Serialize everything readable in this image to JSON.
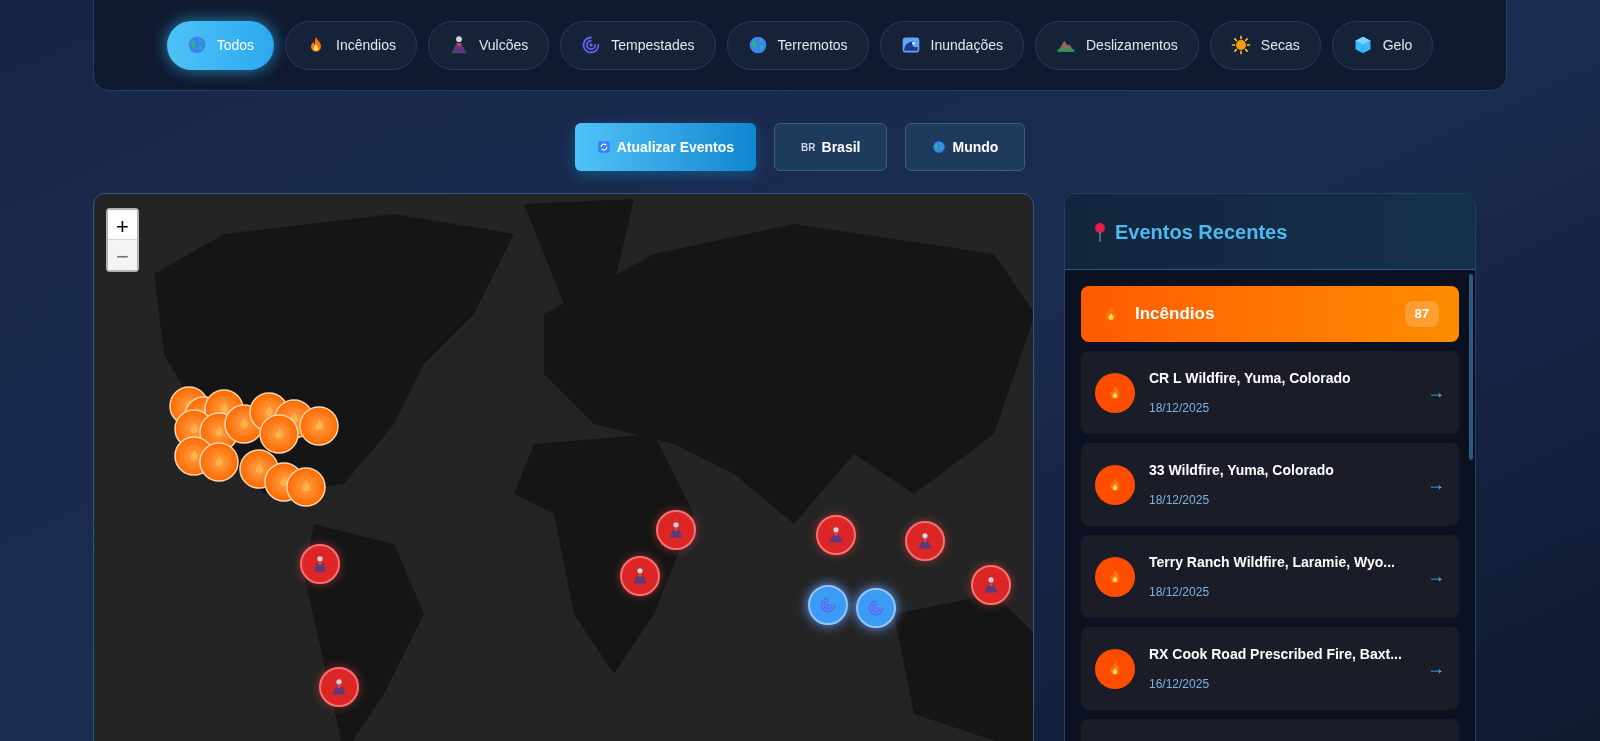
{
  "filters": [
    {
      "label": "Todos",
      "kind": "globe",
      "selected": true
    },
    {
      "label": "Incêndios",
      "kind": "fire",
      "selected": false
    },
    {
      "label": "Vulcões",
      "kind": "volcano",
      "selected": false
    },
    {
      "label": "Tempestades",
      "kind": "storm",
      "selected": false
    },
    {
      "label": "Terremotos",
      "kind": "globe",
      "selected": false
    },
    {
      "label": "Inundações",
      "kind": "wave",
      "selected": false
    },
    {
      "label": "Deslizamentos",
      "kind": "mountain",
      "selected": false
    },
    {
      "label": "Secas",
      "kind": "sun",
      "selected": false
    },
    {
      "label": "Gelo",
      "kind": "ice",
      "selected": false
    }
  ],
  "actions": [
    {
      "label": "Atualizar Eventos",
      "kind": "refresh",
      "primary": true
    },
    {
      "label": "Brasil",
      "kind": "flag",
      "flag": "BR",
      "primary": false
    },
    {
      "label": "Mundo",
      "kind": "globe",
      "primary": false
    }
  ],
  "map": {
    "markers": [
      {
        "kind": "fire"
      },
      {
        "kind": "fire"
      },
      {
        "kind": "fire"
      },
      {
        "kind": "fire"
      },
      {
        "kind": "fire"
      },
      {
        "kind": "fire"
      },
      {
        "kind": "fire"
      },
      {
        "kind": "fire"
      },
      {
        "kind": "fire"
      },
      {
        "kind": "fire"
      },
      {
        "kind": "fire"
      },
      {
        "kind": "fire"
      },
      {
        "kind": "fire"
      },
      {
        "kind": "fire"
      },
      {
        "kind": "fire"
      },
      {
        "kind": "volcano"
      },
      {
        "kind": "volcano"
      },
      {
        "kind": "volcano"
      },
      {
        "kind": "volcano"
      },
      {
        "kind": "volcano"
      },
      {
        "kind": "volcano"
      },
      {
        "kind": "volcano"
      },
      {
        "kind": "storm"
      },
      {
        "kind": "storm"
      }
    ],
    "zoom_in": "+",
    "zoom_out": "−"
  },
  "panel": {
    "title": "Eventos Recentes",
    "group": {
      "label": "Incêndios",
      "kind": "fire",
      "count": "87"
    },
    "events": [
      {
        "title": "CR L Wildfire, Yuma, Colorado",
        "date": "18/12/2025",
        "kind": "fire"
      },
      {
        "title": "33 Wildfire, Yuma, Colorado",
        "date": "18/12/2025",
        "kind": "fire"
      },
      {
        "title": "Terry Ranch Wildfire, Laramie, Wyo...",
        "date": "18/12/2025",
        "kind": "fire"
      },
      {
        "title": "RX Cook Road Prescribed Fire, Baxt...",
        "date": "16/12/2025",
        "kind": "fire"
      }
    ],
    "arrow": "→"
  }
}
